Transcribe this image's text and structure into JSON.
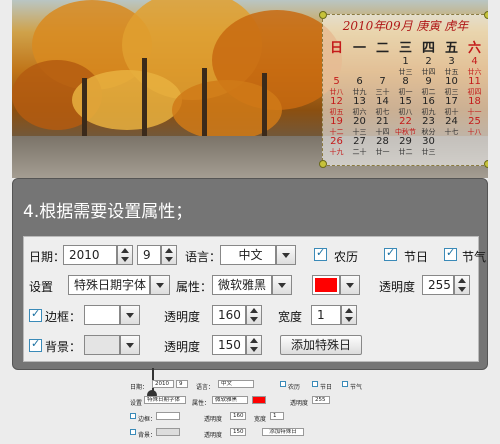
{
  "calendar": {
    "title": "2010年09月 庚寅 虎年",
    "weekdays": [
      "日",
      "一",
      "二",
      "三",
      "四",
      "五",
      "六"
    ],
    "weeks": [
      [
        {
          "d": "",
          "l": ""
        },
        {
          "d": "",
          "l": ""
        },
        {
          "d": "",
          "l": ""
        },
        {
          "d": "1",
          "l": "廿三"
        },
        {
          "d": "2",
          "l": "廿四"
        },
        {
          "d": "3",
          "l": "廿五"
        },
        {
          "d": "4",
          "l": "廿六"
        }
      ],
      [
        {
          "d": "5",
          "l": "廿八"
        },
        {
          "d": "6",
          "l": "廿九"
        },
        {
          "d": "7",
          "l": "三十"
        },
        {
          "d": "8",
          "l": "初一"
        },
        {
          "d": "9",
          "l": "初二"
        },
        {
          "d": "10",
          "l": "初三"
        },
        {
          "d": "11",
          "l": "初四"
        }
      ],
      [
        {
          "d": "12",
          "l": "初五"
        },
        {
          "d": "13",
          "l": "初六"
        },
        {
          "d": "14",
          "l": "初七"
        },
        {
          "d": "15",
          "l": "初八"
        },
        {
          "d": "16",
          "l": "初九"
        },
        {
          "d": "17",
          "l": "初十"
        },
        {
          "d": "18",
          "l": "十一"
        }
      ],
      [
        {
          "d": "19",
          "l": "十二"
        },
        {
          "d": "20",
          "l": "十三"
        },
        {
          "d": "21",
          "l": "十四"
        },
        {
          "d": "22",
          "l": "中秋节"
        },
        {
          "d": "23",
          "l": "秋分"
        },
        {
          "d": "24",
          "l": "十七"
        },
        {
          "d": "25",
          "l": "十八"
        }
      ],
      [
        {
          "d": "26",
          "l": "十九"
        },
        {
          "d": "27",
          "l": "二十"
        },
        {
          "d": "28",
          "l": "廿一"
        },
        {
          "d": "29",
          "l": "廿二"
        },
        {
          "d": "30",
          "l": "廿三"
        },
        {
          "d": "",
          "l": ""
        },
        {
          "d": "",
          "l": ""
        }
      ]
    ],
    "holiday_color": "#c41a1a"
  },
  "panel": {
    "title": "4.根据需要设置属性；"
  },
  "form": {
    "date_label": "日期：",
    "year": "2010",
    "month": "9",
    "language_label": "语言：",
    "language": "中文",
    "lunar_label": "农历",
    "festival_label": "节日",
    "solar_term_label": "节气",
    "setting_label": "设置",
    "setting_value": "特殊日期字体",
    "property_label": "属性：",
    "property_value": "微软雅黑",
    "color_value": "#ff0000",
    "opacity_label": "透明度",
    "opacity_value": "255",
    "border_label": "边框：",
    "border_opacity_label": "透明度",
    "border_opacity_value": "160",
    "width_label": "宽度",
    "width_value": "1",
    "bg_label": "背景：",
    "bg_opacity_label": "透明度",
    "bg_opacity_value": "150",
    "add_special_button": "添加特殊日"
  }
}
